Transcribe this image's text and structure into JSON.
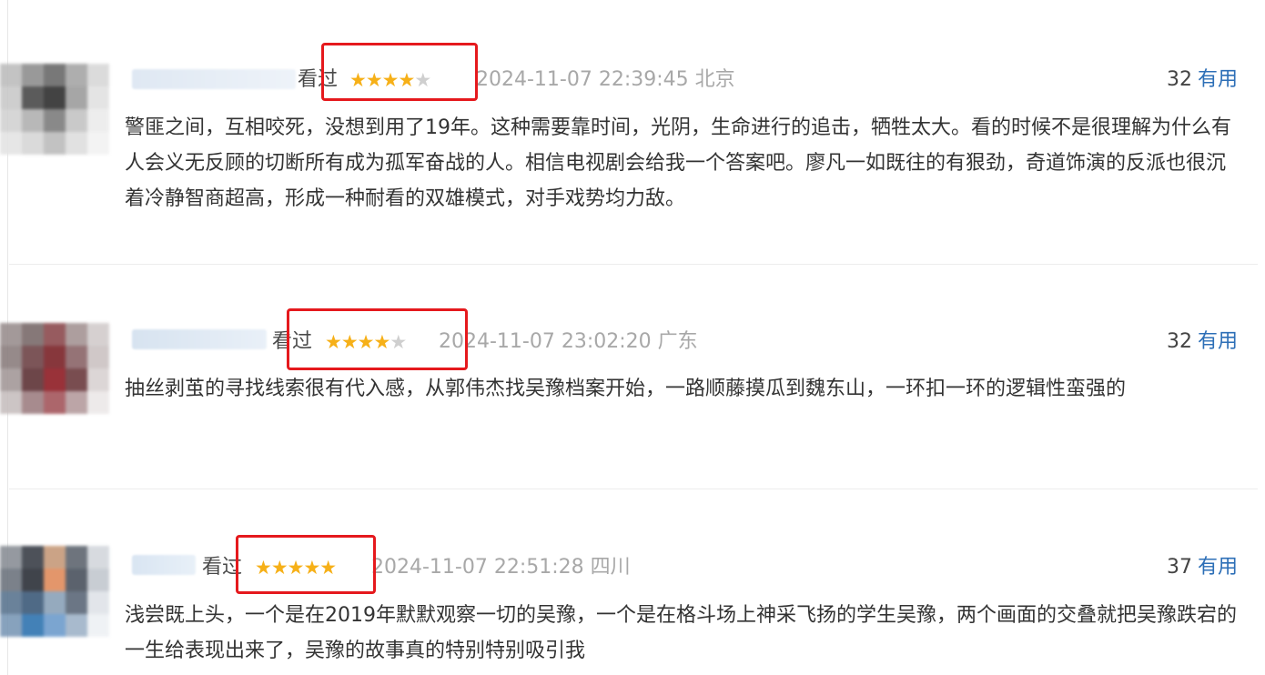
{
  "colors": {
    "accent_link": "#2d6fb7",
    "star_on": "#f6b018",
    "star_off": "#cfcfcf",
    "highlight_box": "#e5191d"
  },
  "reviews": [
    {
      "status": "看过",
      "rating": 4,
      "rating_max": 5,
      "timestamp": "2024-11-07 22:39:45",
      "location": "北京",
      "useful_count": "32",
      "useful_label": "有用",
      "text": "警匪之间，互相咬死，没想到用了19年。这种需要靠时间，光阴，生命进行的追击，牺牲太大。看的时候不是很理解为什么有人会义无反顾的切断所有成为孤军奋战的人。相信电视剧会给我一个答案吧。廖凡一如既往的有狠劲，奇道饰演的反派也很沉着冷静智商超高，形成一种耐看的双雄模式，对手戏势均力敌。",
      "star_glyphs": "★★★★★"
    },
    {
      "status": "看过",
      "rating": 4,
      "rating_max": 5,
      "timestamp": "2024-11-07 23:02:20",
      "location": "广东",
      "useful_count": "32",
      "useful_label": "有用",
      "text": "抽丝剥茧的寻找线索很有代入感，从郭伟杰找吴豫档案开始，一路顺藤摸瓜到魏东山，一环扣一环的逻辑性蛮强的",
      "star_glyphs": "★★★★★"
    },
    {
      "status": "看过",
      "rating": 5,
      "rating_max": 5,
      "timestamp": "2024-11-07 22:51:28",
      "location": "四川",
      "useful_count": "37",
      "useful_label": "有用",
      "text": "浅尝既上头，一个是在2019年默默观察一切的吴豫，一个是在格斗场上神采飞扬的学生吴豫，两个画面的交叠就把吴豫跌宕的一生给表现出来了，吴豫的故事真的特别特别吸引我",
      "star_glyphs": "★★★★★"
    }
  ]
}
